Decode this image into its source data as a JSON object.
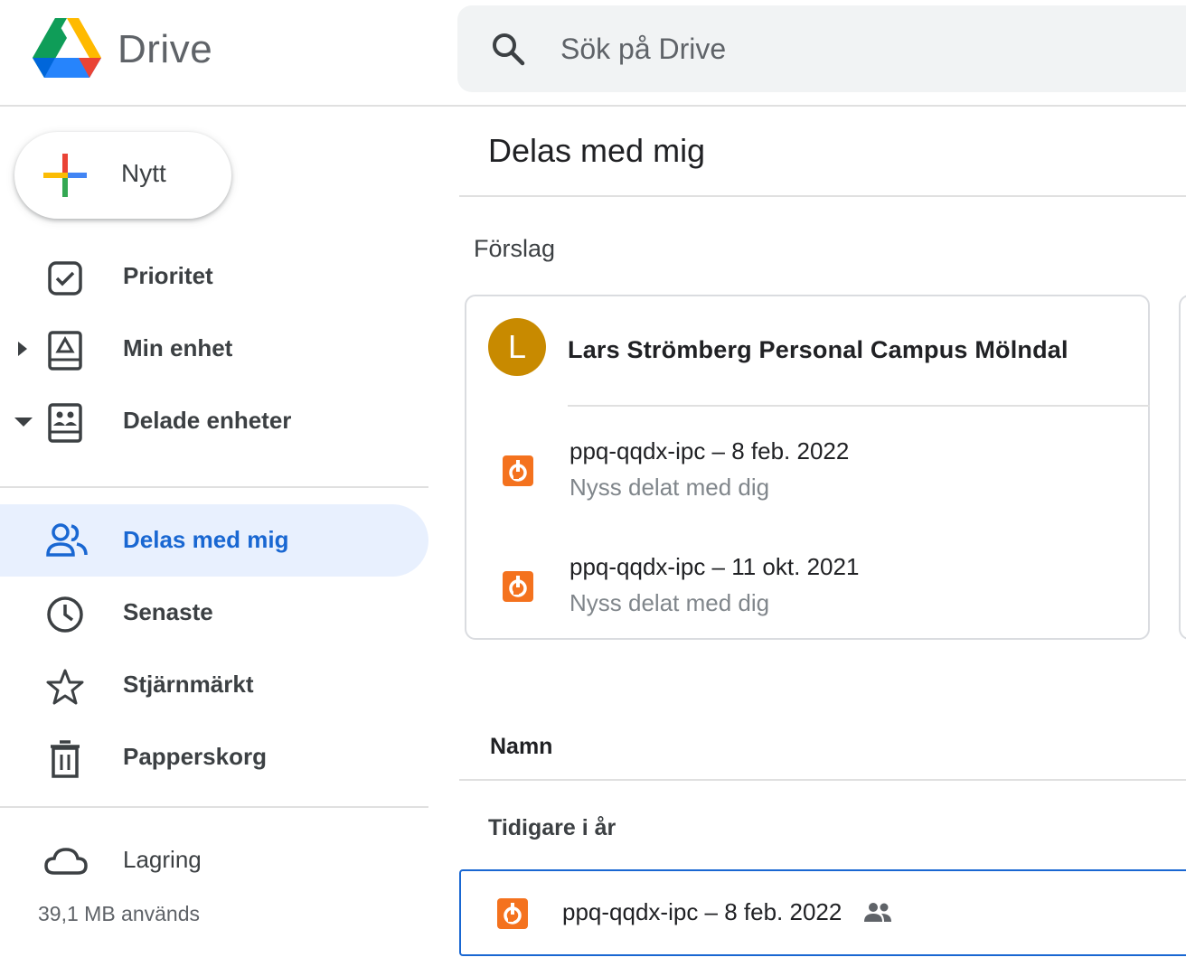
{
  "header": {
    "app_name": "Drive",
    "search_placeholder": "Sök på Drive"
  },
  "sidebar": {
    "new_label": "Nytt",
    "items": [
      {
        "label": "Prioritet",
        "icon": "priority-check-icon"
      },
      {
        "label": "Min enhet",
        "icon": "my-drive-icon"
      },
      {
        "label": "Delade enheter",
        "icon": "shared-drives-icon"
      },
      {
        "label": "Delas med mig",
        "icon": "people-icon",
        "active": true
      },
      {
        "label": "Senaste",
        "icon": "clock-icon"
      },
      {
        "label": "Stjärnmärkt",
        "icon": "star-icon"
      },
      {
        "label": "Papperskorg",
        "icon": "trash-icon"
      },
      {
        "label": "Lagring",
        "icon": "cloud-icon"
      }
    ],
    "storage_used": "39,1 MB används"
  },
  "main": {
    "title": "Delas med mig",
    "suggestions_label": "Förslag",
    "card": {
      "avatar_letter": "L",
      "owner": "Lars Strömberg Personal Campus Mölndal",
      "files": [
        {
          "name": "ppq-qqdx-ipc – 8 feb. 2022",
          "subtitle": "Nyss delat med dig"
        },
        {
          "name": "ppq-qqdx-ipc – 11 okt. 2021",
          "subtitle": "Nyss delat med dig"
        }
      ]
    },
    "column_name": "Namn",
    "group_label": "Tidigare i år",
    "rows": [
      {
        "name": "ppq-qqdx-ipc – 8 feb. 2022",
        "shared": true
      }
    ]
  },
  "colors": {
    "accent": "#1967d2",
    "active_bg": "#e8f0fe",
    "file_icon": "#f4721e",
    "avatar": "#c88a00"
  }
}
